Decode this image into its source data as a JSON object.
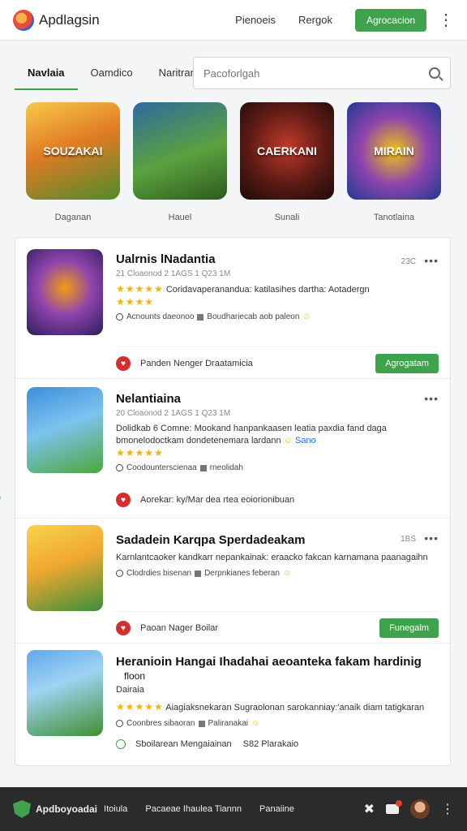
{
  "header": {
    "brand": "Apdlagsin",
    "nav": [
      "Pienoeis",
      "Rergok"
    ],
    "cta": "Agrocacion"
  },
  "tabs": [
    "Navlaia",
    "Oamdico",
    "Naritrar"
  ],
  "search": {
    "placeholder": "Pacoforlgah"
  },
  "featured": [
    {
      "title": "SOUZAKAI",
      "label": "Daganan"
    },
    {
      "title": "",
      "label": "Hauel"
    },
    {
      "title": "CAERKANI",
      "label": "Sunali"
    },
    {
      "title": "MIRAIN",
      "label": "Tanotlaina"
    }
  ],
  "apps": [
    {
      "title": "Ualrnis lNadantia",
      "meta": "21 Cloaonod 2 1AGS 1 Q23 1M",
      "desc": "Coridavaperanandua: katilasihes dartha: Aotadergn",
      "stars": "★★★★★",
      "stars2": "★★★★",
      "sub": "Acnounts daeonoo",
      "sub2": "Boudhariecab aob paleon",
      "num": "23C",
      "foot": "Panden Nenger Draatamicia",
      "button": "Agrogatam"
    },
    {
      "title": "Nelantiaina",
      "meta": "20 Cloaonod 2 1AGS 1 Q23 1M",
      "desc": "Dolidkab 6 Comne: Mookand hanpankaasen leatia paxdia fand daga bmonelodoctkam dondetenemara lardann",
      "descLink": "Sano",
      "stars": "★★★★★",
      "sub": "Coodounterscienaa",
      "sub2": "rneolidah",
      "foot": "Aorekar: ky/Mar dea rtea eoiorionibuan",
      "side": "110"
    },
    {
      "title": "Sadadein Karqpa Sperdadeakam",
      "meta": "",
      "desc": "Karnlantcaoker kandkarr nepankainak: eraacko fakcan karnamana paanagaihn",
      "stars": "",
      "sub": "Clodrdies bisenan",
      "sub2": "Derpnkianes feberan",
      "num": "1BS",
      "foot": "Paoan Nager Boilar",
      "button": "Funegalm"
    },
    {
      "title": "Heranioin Hangai Ihadahai aeoanteka fakam hardinig",
      "extra": "floon",
      "title2": "Dairaia",
      "desc": "Aiagiaksnekaran Sugraolonan sarokanniay:'anaik diam tatigkaran",
      "stars": "★★★★★",
      "sub": "Coonbres sibaoran",
      "sub2": "Paliranakai",
      "foot": "Sboilarean Mengaiainan",
      "foot2": "S82 Plarakaio"
    }
  ],
  "bottom": {
    "brand": "Apdboyoadai",
    "items": [
      "Itoiula",
      "Pacaeae Ihaulea Tiannn",
      "Panaiine"
    ]
  },
  "colors": {
    "accent": "#3fa34d",
    "star": "#f4b400",
    "heart": "#d32f2f",
    "footer": "#2b2b2b"
  }
}
